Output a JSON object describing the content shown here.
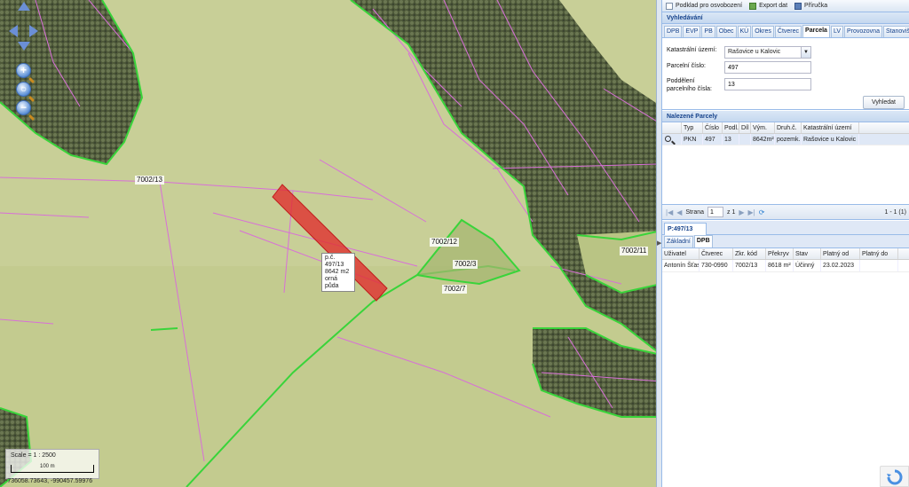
{
  "toolbar": {
    "items": [
      "Podklad pro osvobození",
      "Export dat",
      "Příručka"
    ]
  },
  "search": {
    "header": "Vyhledávání",
    "tabs": [
      "DPB",
      "EVP",
      "PB",
      "Obec",
      "KÚ",
      "Okres",
      "Čtverec",
      "Parcela",
      "LV",
      "Provozovna",
      "Stanoviště včel"
    ],
    "active_tab": "Parcela",
    "cadastral_label": "Katastrální území:",
    "cadastral_value": "Rašovice u Kalovic",
    "parcel_label": "Parcelní číslo:",
    "parcel_value": "497",
    "subdivision_label_1": "Poddělení",
    "subdivision_label_2": "parcelního čísla:",
    "subdivision_value": "13",
    "button": "Vyhledat"
  },
  "found": {
    "header": "Nalezené Parcely",
    "columns": [
      "Typ",
      "Číslo",
      "Podl.",
      "Díl",
      "Vým.",
      "Druh.č.",
      "Katastrální území"
    ],
    "rows": [
      {
        "typ": "PKN",
        "cislo": "497",
        "podl": "13",
        "dil": "",
        "vym": "8642m²",
        "druh": "pozemk...",
        "ku": "Rašovice u Kalovic"
      }
    ],
    "pager": {
      "label": "Strana",
      "page": "1",
      "of": "z 1",
      "summary": "1 - 1 (1)"
    }
  },
  "detail": {
    "tab": "P:497/13",
    "subtabs": [
      "Základní",
      "DPB"
    ],
    "active_subtab": "DPB",
    "columns": [
      "Uživatel",
      "Čtverec",
      "Zkr. kód",
      "Překryv",
      "Stav",
      "Platný od",
      "Platný do"
    ],
    "rows": [
      {
        "uzivatel": "Antonín Šťastný",
        "ctverec": "730-0990",
        "kod": "7002/13",
        "prekryv": "8618 m²",
        "stav": "Účinný",
        "od": "23.02.2023",
        "do": ""
      }
    ]
  },
  "map": {
    "labels": [
      "7002/13",
      "7002/12",
      "7002/3",
      "7002/7",
      "7002/11"
    ],
    "popup": [
      "p.č. 497/13",
      "8642 m2",
      "orná půda"
    ],
    "scale_text": "Scale = 1 : 2500",
    "scale_length": "100 m",
    "coords": "-736058.73643, -990457.59976"
  },
  "colors": {
    "selection": "#e03030",
    "parcel_lines": "#d86fd8",
    "dpb_lines": "#39d43a",
    "panel_header": "#15428b"
  }
}
